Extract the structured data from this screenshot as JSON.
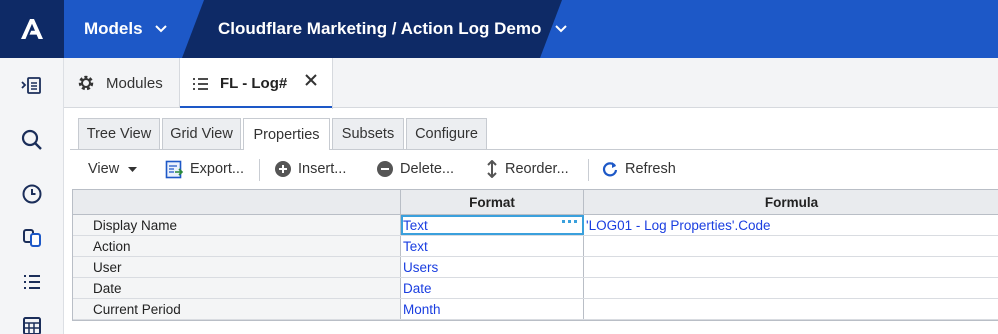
{
  "topbar": {
    "models_label": "Models",
    "breadcrumb": "Cloudflare Marketing / Action Log Demo",
    "brand_color": "#1d58c7",
    "dark_color": "#0e2a66"
  },
  "rail": {
    "items": [
      "expand-panel-icon",
      "search-icon",
      "clock-icon",
      "copy-icon",
      "list-icon",
      "table-icon"
    ]
  },
  "module_tabs": [
    {
      "label": "Modules",
      "icon": "gear-icon"
    },
    {
      "label": "FL - Log#",
      "icon": "list-icon",
      "active": true
    }
  ],
  "view_tabs": [
    "Tree View",
    "Grid View",
    "Properties",
    "Subsets",
    "Configure"
  ],
  "active_view_tab": "Properties",
  "toolbar": {
    "view_label": "View",
    "export_label": "Export...",
    "insert_label": "Insert...",
    "delete_label": "Delete...",
    "reorder_label": "Reorder...",
    "refresh_label": "Refresh"
  },
  "grid": {
    "columns": [
      "Format",
      "Formula"
    ],
    "rows": [
      {
        "name": "Display Name",
        "format": "Text",
        "formula": "'LOG01 - Log Properties'.Code"
      },
      {
        "name": "Action",
        "format": "Text",
        "formula": ""
      },
      {
        "name": "User",
        "format": "Users",
        "formula": ""
      },
      {
        "name": "Date",
        "format": "Date",
        "formula": ""
      },
      {
        "name": "Current Period",
        "format": "Month",
        "formula": ""
      }
    ]
  }
}
